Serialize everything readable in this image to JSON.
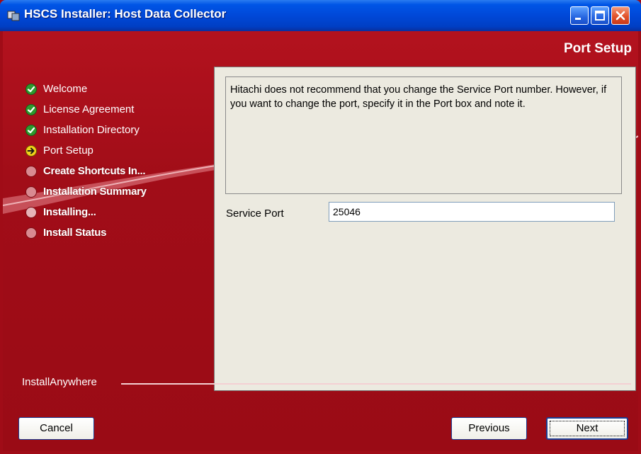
{
  "window": {
    "title": "HSCS Installer: Host Data Collector",
    "titlebar_color": "#0055e6"
  },
  "header": {
    "page_title": "Port Setup"
  },
  "steps": [
    {
      "label": "Welcome",
      "status": "done",
      "icon": "check-icon"
    },
    {
      "label": "License Agreement",
      "status": "done",
      "icon": "check-icon"
    },
    {
      "label": "Installation Directory",
      "status": "done",
      "icon": "check-icon"
    },
    {
      "label": "Port Setup",
      "status": "current",
      "icon": "arrow-right-icon"
    },
    {
      "label": "Create Shortcuts In...",
      "status": "pending",
      "icon": "circle-icon"
    },
    {
      "label": "Installation Summary",
      "status": "pending",
      "icon": "circle-icon"
    },
    {
      "label": "Installing...",
      "status": "pending",
      "icon": "circle-icon"
    },
    {
      "label": "Install Status",
      "status": "pending",
      "icon": "circle-icon"
    }
  ],
  "panel": {
    "message": "Hitachi does not recommend that you change the Service Port number. However, if you want to change the port, specify it in the Port box and note it.",
    "port_label": "Service Port",
    "port_value": "25046"
  },
  "footer": {
    "brand": "InstallAnywhere",
    "cancel_label": "Cancel",
    "previous_label": "Previous",
    "next_label": "Next"
  },
  "colors": {
    "background_red": "#a00c17",
    "panel_bg": "#eceae0",
    "done_green": "#2e9a2e",
    "current_yellow": "#f2d21a"
  }
}
